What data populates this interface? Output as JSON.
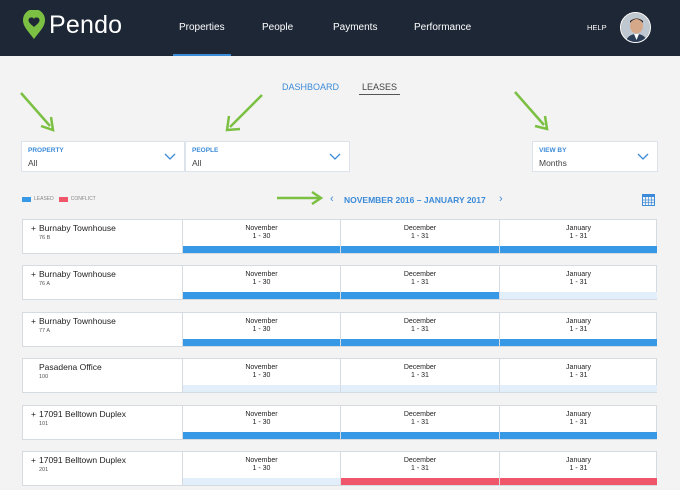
{
  "app": {
    "logo_text": "Pendo",
    "nav": [
      "Properties",
      "People",
      "Payments",
      "Performance"
    ],
    "help": "HELP"
  },
  "subtabs": {
    "dashboard": "DASHBOARD",
    "leases": "LEASES"
  },
  "filters": {
    "property": {
      "label": "PROPERTY",
      "value": "All"
    },
    "people": {
      "label": "PEOPLE",
      "value": "All"
    },
    "view_by": {
      "label": "VIEW BY",
      "value": "Months"
    }
  },
  "legend": {
    "leased": "LEASED",
    "conflict": "CONFLICT"
  },
  "date_range": "NOVEMBER 2016 – JANUARY 2017",
  "colors": {
    "leased": "#3799e6",
    "conflict": "#f0566a",
    "empty": "#e2eef9",
    "accent": "#3b8bd9",
    "nav_bg": "#1e2736"
  },
  "months": [
    {
      "name": "November",
      "range": "1 - 30"
    },
    {
      "name": "December",
      "range": "1 - 31"
    },
    {
      "name": "January",
      "range": "1 - 31"
    }
  ],
  "rows": [
    {
      "prefix": "+",
      "name": "Burnaby Townhouse",
      "unit": "76 B",
      "status": [
        "leased",
        "leased",
        "leased"
      ]
    },
    {
      "prefix": "+",
      "name": "Burnaby Townhouse",
      "unit": "76 A",
      "status": [
        "leased",
        "leased",
        "empty"
      ]
    },
    {
      "prefix": "+",
      "name": "Burnaby Townhouse",
      "unit": "77 A",
      "status": [
        "leased",
        "leased",
        "leased"
      ]
    },
    {
      "prefix": "",
      "name": "Pasadena Office",
      "unit": "100",
      "status": [
        "empty",
        "empty",
        "empty"
      ]
    },
    {
      "prefix": "+",
      "name": "17091 Belltown Duplex",
      "unit": "101",
      "status": [
        "leased",
        "leased",
        "leased"
      ]
    },
    {
      "prefix": "+",
      "name": "17091 Belltown Duplex",
      "unit": "201",
      "status": [
        "empty",
        "conflict",
        "conflict"
      ]
    }
  ]
}
